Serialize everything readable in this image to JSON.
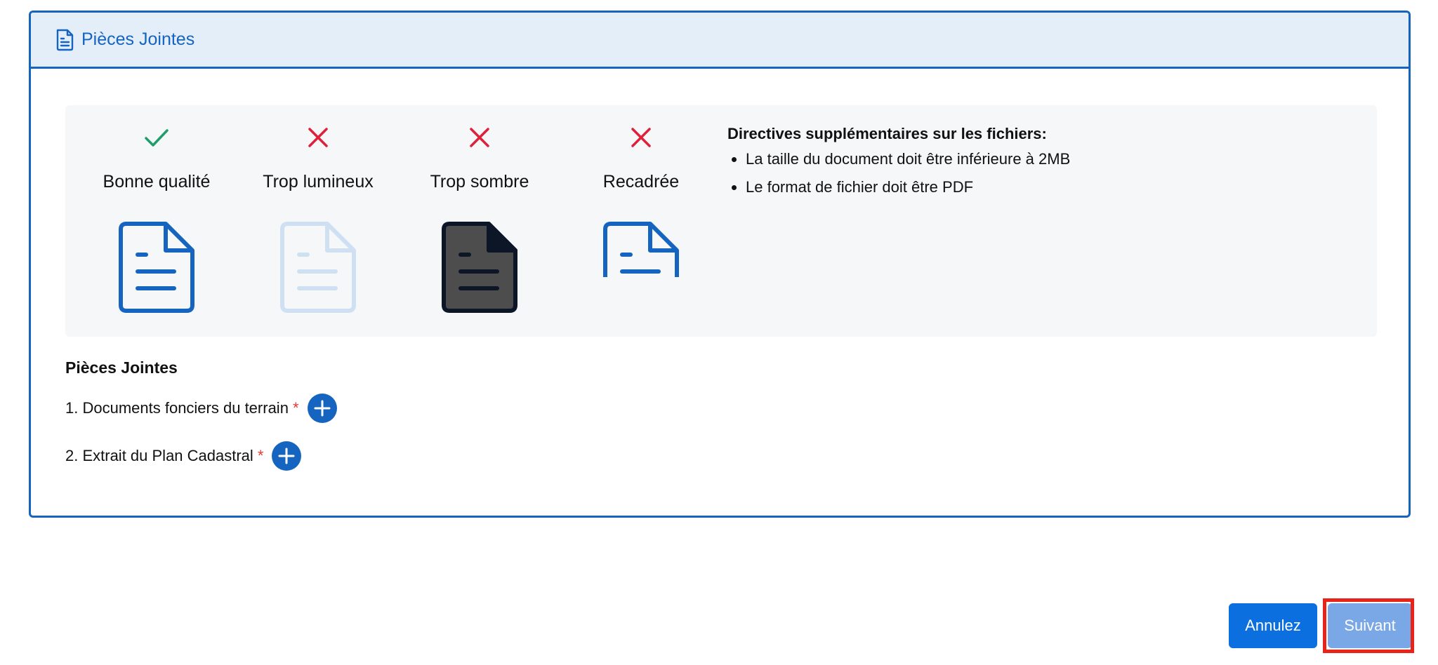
{
  "header": {
    "title": "Pièces Jointes",
    "icon": "document-icon"
  },
  "examples": [
    {
      "status": "good",
      "mark_icon": "check-icon",
      "label": "Bonne qualité",
      "doc_style": "normal"
    },
    {
      "status": "bad",
      "mark_icon": "x-icon",
      "label": "Trop lumineux",
      "doc_style": "light"
    },
    {
      "status": "bad",
      "mark_icon": "x-icon",
      "label": "Trop sombre",
      "doc_style": "dark"
    },
    {
      "status": "bad",
      "mark_icon": "x-icon",
      "label": "Recadrée",
      "doc_style": "cropped"
    }
  ],
  "guidelines": {
    "title": "Directives supplémentaires sur les fichiers:",
    "items": [
      "La taille du document doit être inférieure à 2MB",
      "Le format de fichier doit être PDF"
    ]
  },
  "attachments": {
    "title": "Pièces Jointes",
    "items": [
      {
        "label": "1. Documents fonciers du terrain",
        "required": "*"
      },
      {
        "label": "2. Extrait du Plan Cadastral",
        "required": "*"
      }
    ]
  },
  "actions": {
    "cancel_label": "Annulez",
    "next_label": "Suivant"
  },
  "colors": {
    "primary": "#1565c0",
    "header_bg": "#e3eef9",
    "panel_bg": "#f5f7f9",
    "good": "#1e9e6a",
    "bad": "#e0203a",
    "required": "#e53935",
    "cancel_bg": "#0b6fe0",
    "next_bg": "#7aa7e6",
    "highlight": "#e8231a"
  }
}
